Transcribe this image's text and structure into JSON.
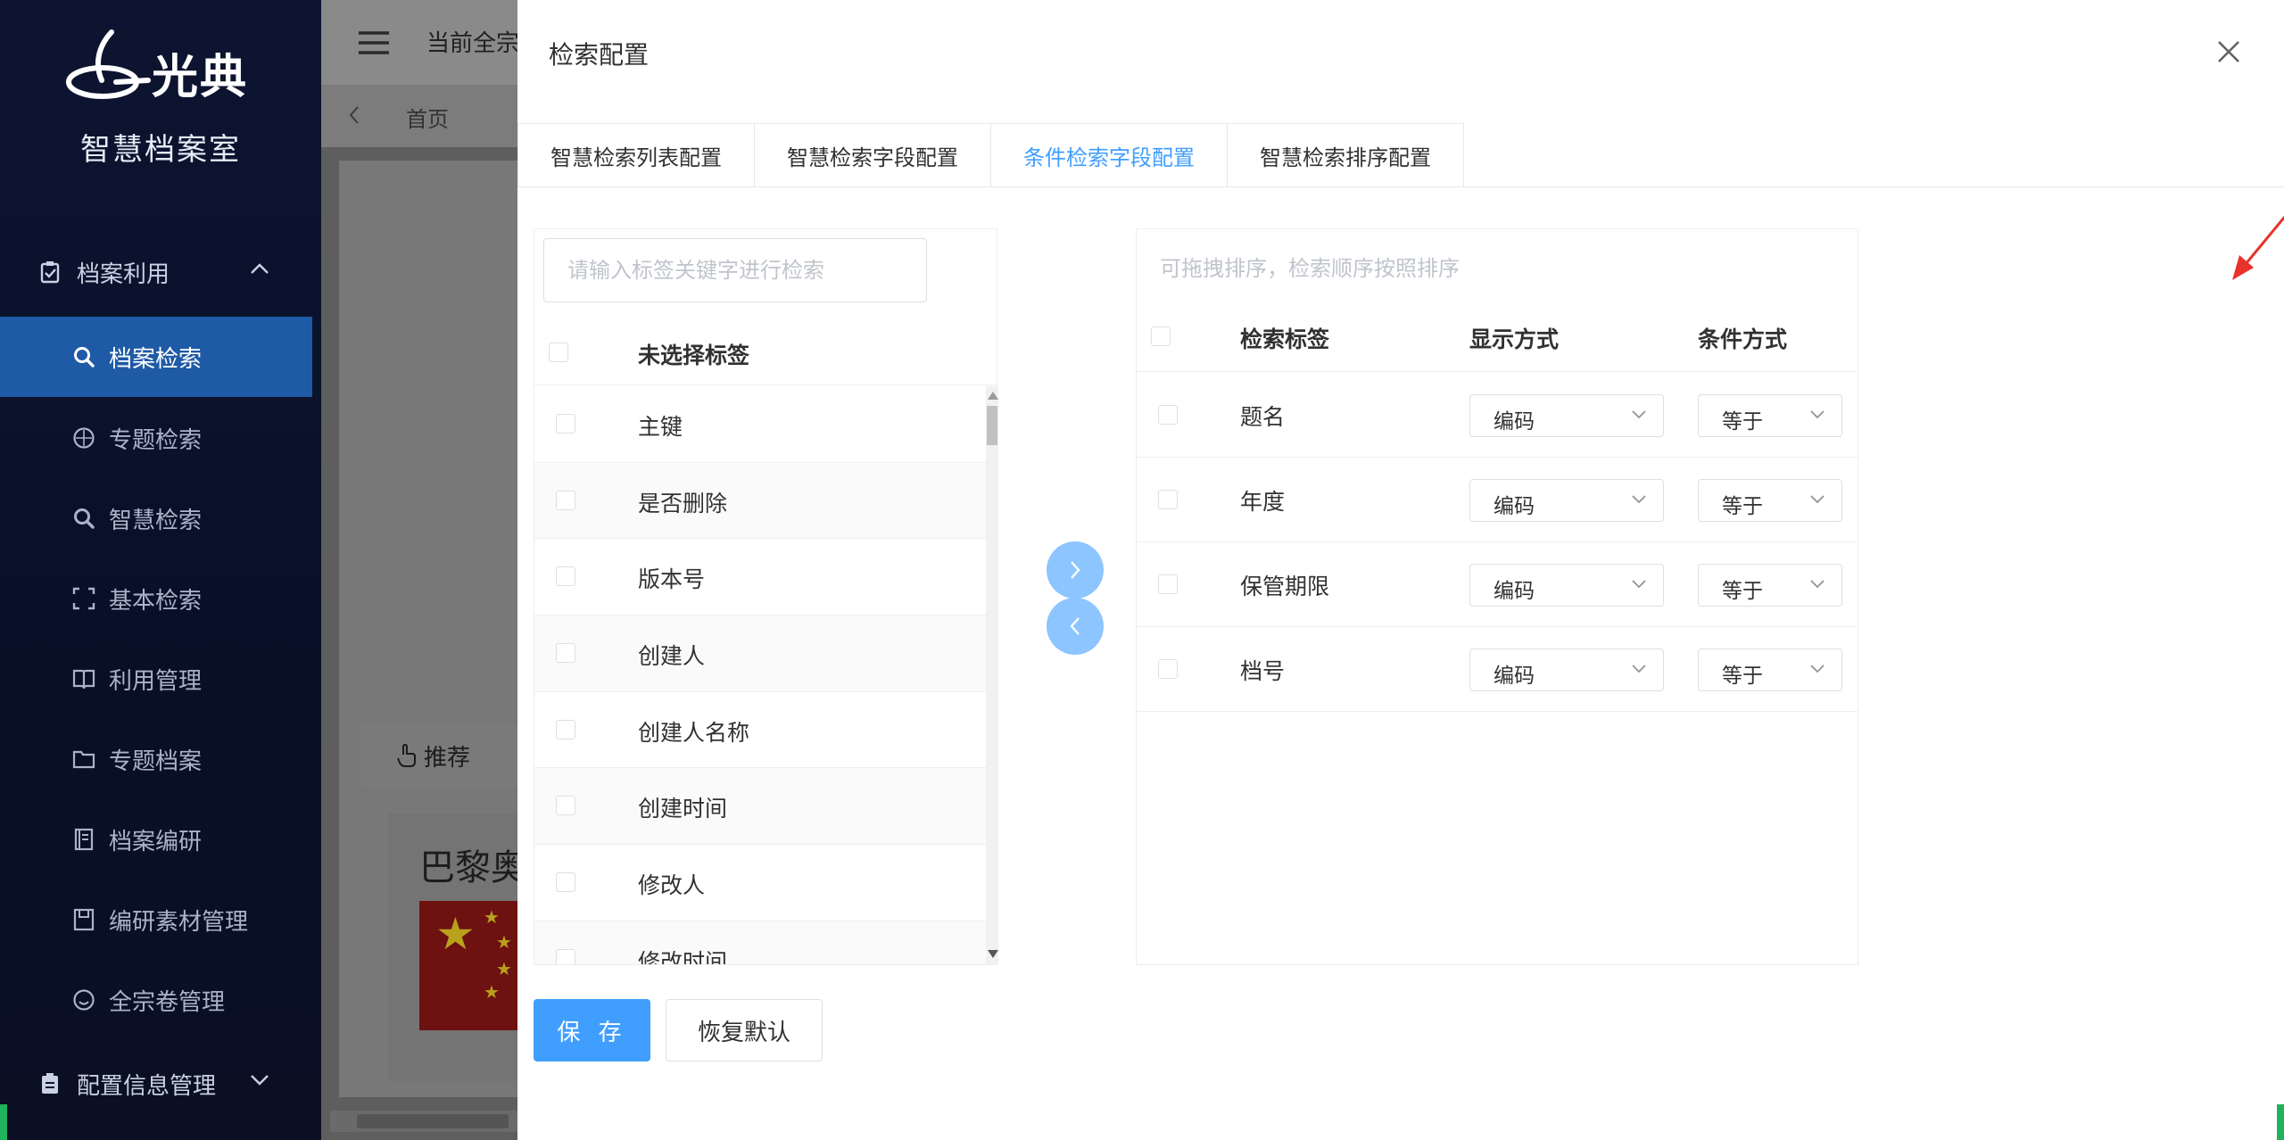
{
  "sidebar": {
    "brand": "光典",
    "system_title": "智慧档案室",
    "groups": [
      {
        "label": "档案利用",
        "icon": "clipboard-check-icon"
      },
      {
        "label": "配置信息管理",
        "icon": "clipboard-icon"
      }
    ],
    "items": [
      {
        "label": "档案检索",
        "icon": "search-icon",
        "active": true
      },
      {
        "label": "专题检索",
        "icon": "compass-icon"
      },
      {
        "label": "智慧检索",
        "icon": "search-icon"
      },
      {
        "label": "基本检索",
        "icon": "scan-icon"
      },
      {
        "label": "利用管理",
        "icon": "book-icon"
      },
      {
        "label": "专题档案",
        "icon": "folder-icon"
      },
      {
        "label": "档案编研",
        "icon": "notebook-icon"
      },
      {
        "label": "编研素材管理",
        "icon": "save-icon"
      },
      {
        "label": "全宗卷管理",
        "icon": "smile-icon"
      }
    ]
  },
  "background": {
    "current_label": "当前全宗",
    "home_tab": "首页",
    "recommend_tab": "推荐",
    "news_title": "巴黎奥"
  },
  "drawer": {
    "title": "检索配置",
    "tabs": [
      {
        "label": "智慧检索列表配置",
        "active": false
      },
      {
        "label": "智慧检索字段配置",
        "active": false
      },
      {
        "label": "条件检索字段配置",
        "active": true
      },
      {
        "label": "智慧检索排序配置",
        "active": false
      }
    ],
    "left": {
      "search_placeholder": "请输入标签关键字进行检索",
      "header": "未选择标签",
      "rows": [
        "主键",
        "是否删除",
        "版本号",
        "创建人",
        "创建人名称",
        "创建时间",
        "修改人",
        "修改时间"
      ]
    },
    "right": {
      "hint": "可拖拽排序，检索顺序按照排序",
      "headers": {
        "label": "检索标签",
        "display": "显示方式",
        "condition": "条件方式"
      },
      "rows": [
        {
          "label": "题名",
          "display": "编码",
          "condition": "等于"
        },
        {
          "label": "年度",
          "display": "编码",
          "condition": "等于"
        },
        {
          "label": "保管期限",
          "display": "编码",
          "condition": "等于"
        },
        {
          "label": "档号",
          "display": "编码",
          "condition": "等于"
        }
      ]
    },
    "buttons": {
      "save": "保 存",
      "reset": "恢复默认"
    }
  },
  "colors": {
    "primary": "#409eff",
    "sidebar_bg": "#0c1431",
    "sidebar_active": "#1f5aa6",
    "transfer_button": "#8cc5ff",
    "annotation_arrow": "#e8322b"
  }
}
